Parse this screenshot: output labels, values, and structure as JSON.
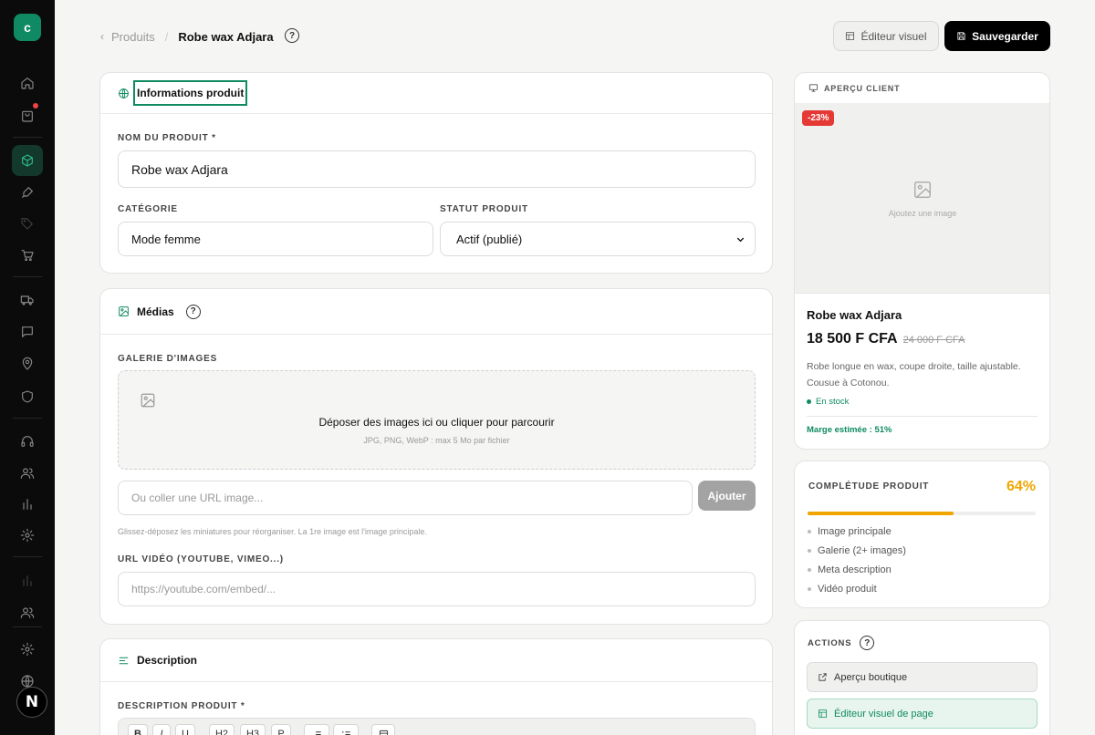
{
  "app": {
    "logo_letter": "c",
    "avatar_letter": "N"
  },
  "colors": {
    "brand": "#0f8a62",
    "accent_orange": "#f0a500",
    "discount_red": "#e53935",
    "sidebar_bg": "#0b0b0b"
  },
  "sidebar": {
    "items": [
      {
        "icon": "home-icon"
      },
      {
        "icon": "shopping-bag-icon"
      },
      {
        "icon": "box-icon"
      },
      {
        "icon": "brush-icon"
      },
      {
        "icon": "tag-icon"
      },
      {
        "icon": "cart-icon"
      },
      {
        "icon": "truck-icon"
      },
      {
        "icon": "message-icon"
      },
      {
        "icon": "map-pin-icon"
      },
      {
        "icon": "shield-icon"
      },
      {
        "icon": "headphones-icon"
      },
      {
        "icon": "users-icon"
      },
      {
        "icon": "bar-chart-icon"
      },
      {
        "icon": "settings-icon"
      },
      {
        "icon": "bar-chart-icon"
      },
      {
        "icon": "users-icon"
      },
      {
        "icon": "settings-icon"
      },
      {
        "icon": "globe-icon"
      }
    ]
  },
  "header": {
    "breadcrumb_parent": "Produits",
    "breadcrumb_current": "Robe wax Adjara",
    "help": "?",
    "visual_editor_label": "Éditeur visuel",
    "save_label": "Sauvegarder"
  },
  "info_card": {
    "title": "Informations produit",
    "name_label": "NOM DU PRODUIT *",
    "name_value": "Robe wax Adjara",
    "category_label": "CATÉGORIE",
    "category_value": "Mode femme",
    "status_label": "STATUT PRODUIT",
    "status_value": "Actif (publié)"
  },
  "media_card": {
    "title": "Médias",
    "help": "?",
    "gallery_label": "GALERIE D'IMAGES",
    "drop_title": "Déposer des images ici ou cliquer pour parcourir",
    "drop_hint": "JPG, PNG, WebP : max 5 Mo par fichier",
    "url_placeholder": "Ou coller une URL image...",
    "add_label": "Ajouter",
    "reorder_hint": "Glissez-déposez les miniatures pour réorganiser. La 1re image est l'image principale.",
    "video_label": "URL VIDÉO (YOUTUBE, VIMEO...)",
    "video_placeholder": "https://youtube.com/embed/..."
  },
  "description_card": {
    "title": "Description",
    "desc_label": "DESCRIPTION PRODUIT *",
    "toolbar": {
      "bold": "B",
      "italic": "I",
      "underline": "U",
      "h2": "H2",
      "h3": "H3",
      "p": "P"
    }
  },
  "preview": {
    "header": "APERÇU CLIENT",
    "discount": "-23%",
    "add_image": "Ajoutez une image",
    "name": "Robe wax Adjara",
    "price": "18 500 F CFA",
    "old_price": "24 000 F CFA",
    "description": "Robe longue en wax, coupe droite, taille ajustable. Cousue à Cotonou.",
    "stock": "En stock",
    "margin": "Marge estimée : 51%"
  },
  "completeness": {
    "title": "COMPLÉTUDE PRODUIT",
    "percent_label": "64%",
    "progress": 0.64,
    "items": [
      "Image principale",
      "Galerie (2+ images)",
      "Meta description",
      "Vidéo produit"
    ]
  },
  "actions": {
    "title": "ACTIONS",
    "help": "?",
    "shop_preview": "Aperçu boutique",
    "page_editor": "Éditeur visuel de page"
  }
}
